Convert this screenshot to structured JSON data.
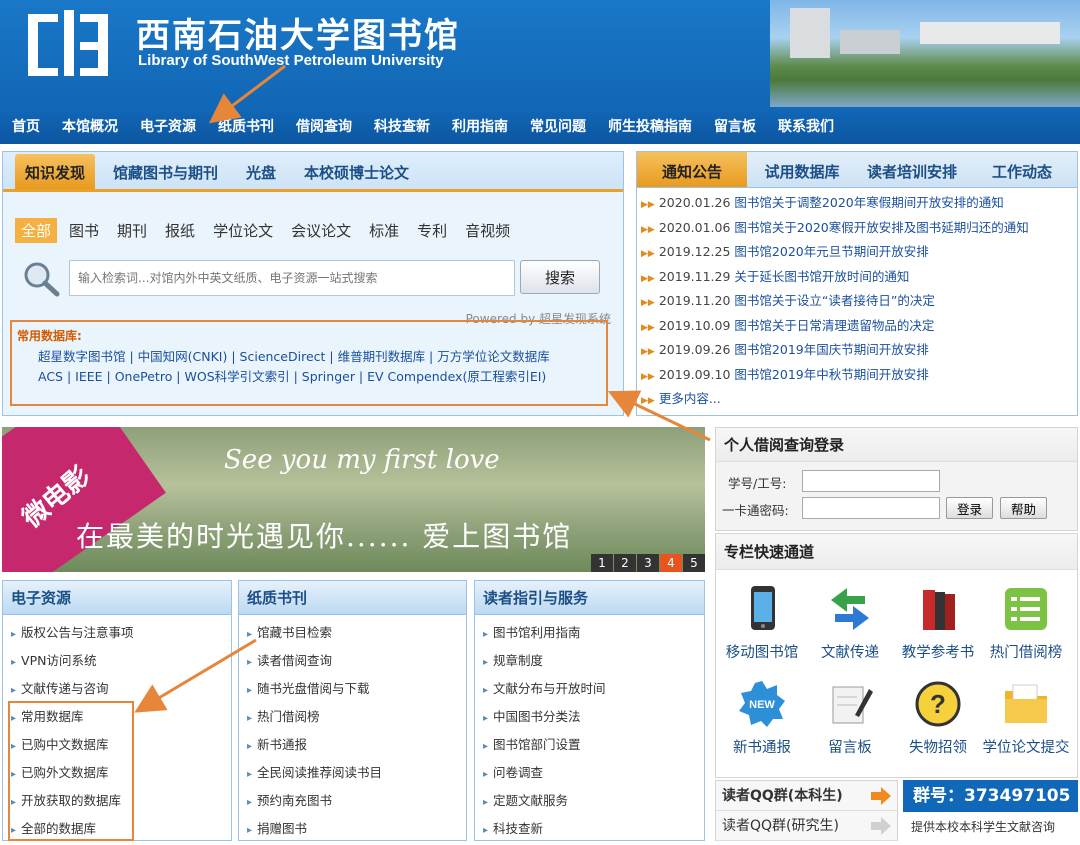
{
  "header": {
    "title": "西南石油大学图书馆",
    "subtitle": "Library of SouthWest Petroleum University"
  },
  "nav": {
    "items": [
      "首页",
      "本馆概况",
      "电子资源",
      "纸质书刊",
      "借阅查询",
      "科技查新",
      "利用指南",
      "常见问题",
      "师生投稿指南",
      "留言板",
      "联系我们"
    ]
  },
  "search": {
    "tabs": [
      "知识发现",
      "馆藏图书与期刊",
      "光盘",
      "本校硕博士论文"
    ],
    "active_tab": "知识发现",
    "categories": [
      "全部",
      "图书",
      "期刊",
      "报纸",
      "学位论文",
      "会议论文",
      "标准",
      "专利",
      "音视频"
    ],
    "placeholder": "输入检索词...对馆内外中英文纸质、电子资源一站式搜索",
    "button": "搜索",
    "powered_by": "Powered by 超星发现系统",
    "db_title": "常用数据库:",
    "db_line_1": "超星数字图书馆 | 中国知网(CNKI) | ScienceDirect | 维普期刊数据库 | 万方学位论文数据库",
    "db_line_2": "ACS | IEEE | OnePetro | WOS科学引文索引 | Springer | EV Compendex(原工程索引EI)"
  },
  "notices": {
    "tabs": [
      "通知公告",
      "试用数据库",
      "读者培训安排",
      "工作动态"
    ],
    "items": [
      {
        "date": "2020.01.26",
        "text": "图书馆关于调整2020年寒假期间开放安排的通知"
      },
      {
        "date": "2020.01.06",
        "text": "图书馆关于2020寒假开放安排及图书延期归还的通知"
      },
      {
        "date": "2019.12.25",
        "text": "图书馆2020年元旦节期间开放安排"
      },
      {
        "date": "2019.11.29",
        "text": "关于延长图书馆开放时间的通知"
      },
      {
        "date": "2019.11.20",
        "text": "图书馆关于设立“读者接待日”的决定"
      },
      {
        "date": "2019.10.09",
        "text": "图书馆关于日常清理遗留物品的决定"
      },
      {
        "date": "2019.09.26",
        "text": "图书馆2019年国庆节期间开放安排"
      },
      {
        "date": "2019.09.10",
        "text": "图书馆2019年中秋节期间开放安排"
      }
    ],
    "more": "更多内容..."
  },
  "banner": {
    "corner_label": "微电影",
    "line_1": "See you my first love",
    "line_2": "在最美的时光遇见你...... 爱上图书馆",
    "pages": [
      "1",
      "2",
      "3",
      "4",
      "5"
    ],
    "active_page": "4"
  },
  "login": {
    "title": "个人借阅查询登录",
    "id_label": "学号/工号:",
    "pwd_label": "一卡通密码:",
    "login_button": "登录",
    "help_button": "帮助"
  },
  "quick": {
    "title": "专栏快速通道",
    "items": [
      "移动图书馆",
      "文献传递",
      "教学参考书",
      "热门借阅榜",
      "新书通报",
      "留言板",
      "失物招领",
      "学位论文提交"
    ]
  },
  "qq": {
    "undergrad": "读者QQ群(本科生)",
    "grad": "读者QQ群(研究生)",
    "number": "群号：373497105",
    "desc": "提供本校本科学生文献咨询"
  },
  "columns": {
    "e_resources": {
      "title": "电子资源",
      "items": [
        "版权公告与注意事项",
        "VPN访问系统",
        "文献传递与咨询",
        "常用数据库",
        "已购中文数据库",
        "已购外文数据库",
        "开放获取的数据库",
        "全部的数据库"
      ]
    },
    "paper": {
      "title": "纸质书刊",
      "items": [
        "馆藏书目检索",
        "读者借阅查询",
        "随书光盘借阅与下载",
        "热门借阅榜",
        "新书通报",
        "全民阅读推荐阅读书目",
        "预约南充图书",
        "捐赠图书"
      ]
    },
    "guide": {
      "title": "读者指引与服务",
      "items": [
        "图书馆利用指南",
        "规章制度",
        "文献分布与开放时间",
        "中国图书分类法",
        "图书馆部门设置",
        "问卷调查",
        "定题文献服务",
        "科技查新"
      ]
    }
  },
  "colors": {
    "brand_blue": "#1167b5",
    "accent_orange": "#e89a1f",
    "annotation": "#e6863a"
  }
}
